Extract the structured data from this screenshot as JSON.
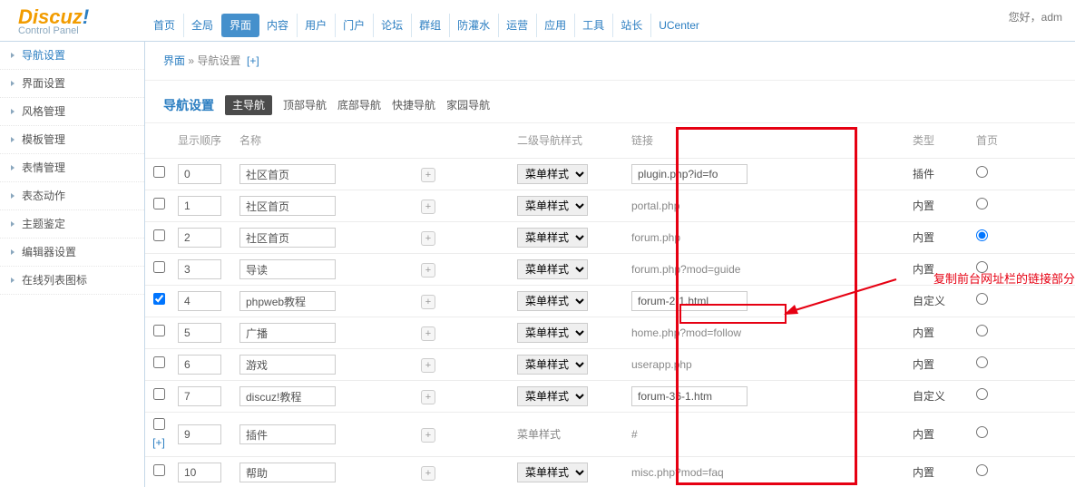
{
  "greet": "您好，adm",
  "logo": {
    "brand": "Discuz",
    "ex": "!",
    "sub": "Control Panel"
  },
  "topnav": [
    "首页",
    "全局",
    "界面",
    "内容",
    "用户",
    "门户",
    "论坛",
    "群组",
    "防灌水",
    "运营",
    "应用",
    "工具",
    "站长",
    "UCenter"
  ],
  "topnav_active": 2,
  "side": [
    "导航设置",
    "界面设置",
    "风格管理",
    "模板管理",
    "表情管理",
    "表态动作",
    "主题鉴定",
    "编辑器设置",
    "在线列表图标"
  ],
  "side_active": 0,
  "crumb": {
    "a": "界面",
    "sep": " » ",
    "b": "导航设置",
    "add": "[+]"
  },
  "tabs": {
    "title": "导航设置",
    "items": [
      "主导航",
      "顶部导航",
      "底部导航",
      "快捷导航",
      "家园导航"
    ],
    "active": 0
  },
  "cols": {
    "order": "显示顺序",
    "name": "名称",
    "style": "二级导航样式",
    "link": "链接",
    "type": "类型",
    "home": "首页"
  },
  "styleOpt": "菜单样式",
  "addmark": "[+]",
  "rows": [
    {
      "ord": "0",
      "name": "社区首页",
      "sty": true,
      "link": "plugin.php?id=fo",
      "linkInput": true,
      "type": "插件",
      "radio": false
    },
    {
      "ord": "1",
      "name": "社区首页",
      "sty": true,
      "link": "portal.php",
      "linkInput": false,
      "type": "内置",
      "radio": false
    },
    {
      "ord": "2",
      "name": "社区首页",
      "sty": true,
      "link": "forum.php",
      "linkInput": false,
      "type": "内置",
      "radio": true
    },
    {
      "ord": "3",
      "name": "导读",
      "sty": true,
      "link": "forum.php?mod=guide",
      "linkInput": false,
      "type": "内置",
      "radio": false
    },
    {
      "ord": "4",
      "name": "phpweb教程",
      "sty": true,
      "link": "forum-2-1.html",
      "linkInput": true,
      "type": "自定义",
      "radio": false,
      "chk": true
    },
    {
      "ord": "5",
      "name": "广播",
      "sty": true,
      "link": "home.php?mod=follow",
      "linkInput": false,
      "type": "内置",
      "radio": false
    },
    {
      "ord": "6",
      "name": "游戏",
      "sty": true,
      "link": "userapp.php",
      "linkInput": false,
      "type": "内置",
      "radio": false
    },
    {
      "ord": "7",
      "name": "discuz!教程",
      "sty": true,
      "link": "forum-36-1.htm",
      "linkInput": true,
      "type": "自定义",
      "radio": false
    },
    {
      "ord": "9",
      "name": "插件",
      "sty": false,
      "styText": "菜单样式",
      "link": "#",
      "linkInput": false,
      "type": "内置",
      "radio": false,
      "add": true
    },
    {
      "ord": "10",
      "name": "帮助",
      "sty": true,
      "link": "misc.php?mod=faq",
      "linkInput": false,
      "type": "内置",
      "radio": false
    }
  ],
  "annot": "复制前台网址栏的链接部分"
}
